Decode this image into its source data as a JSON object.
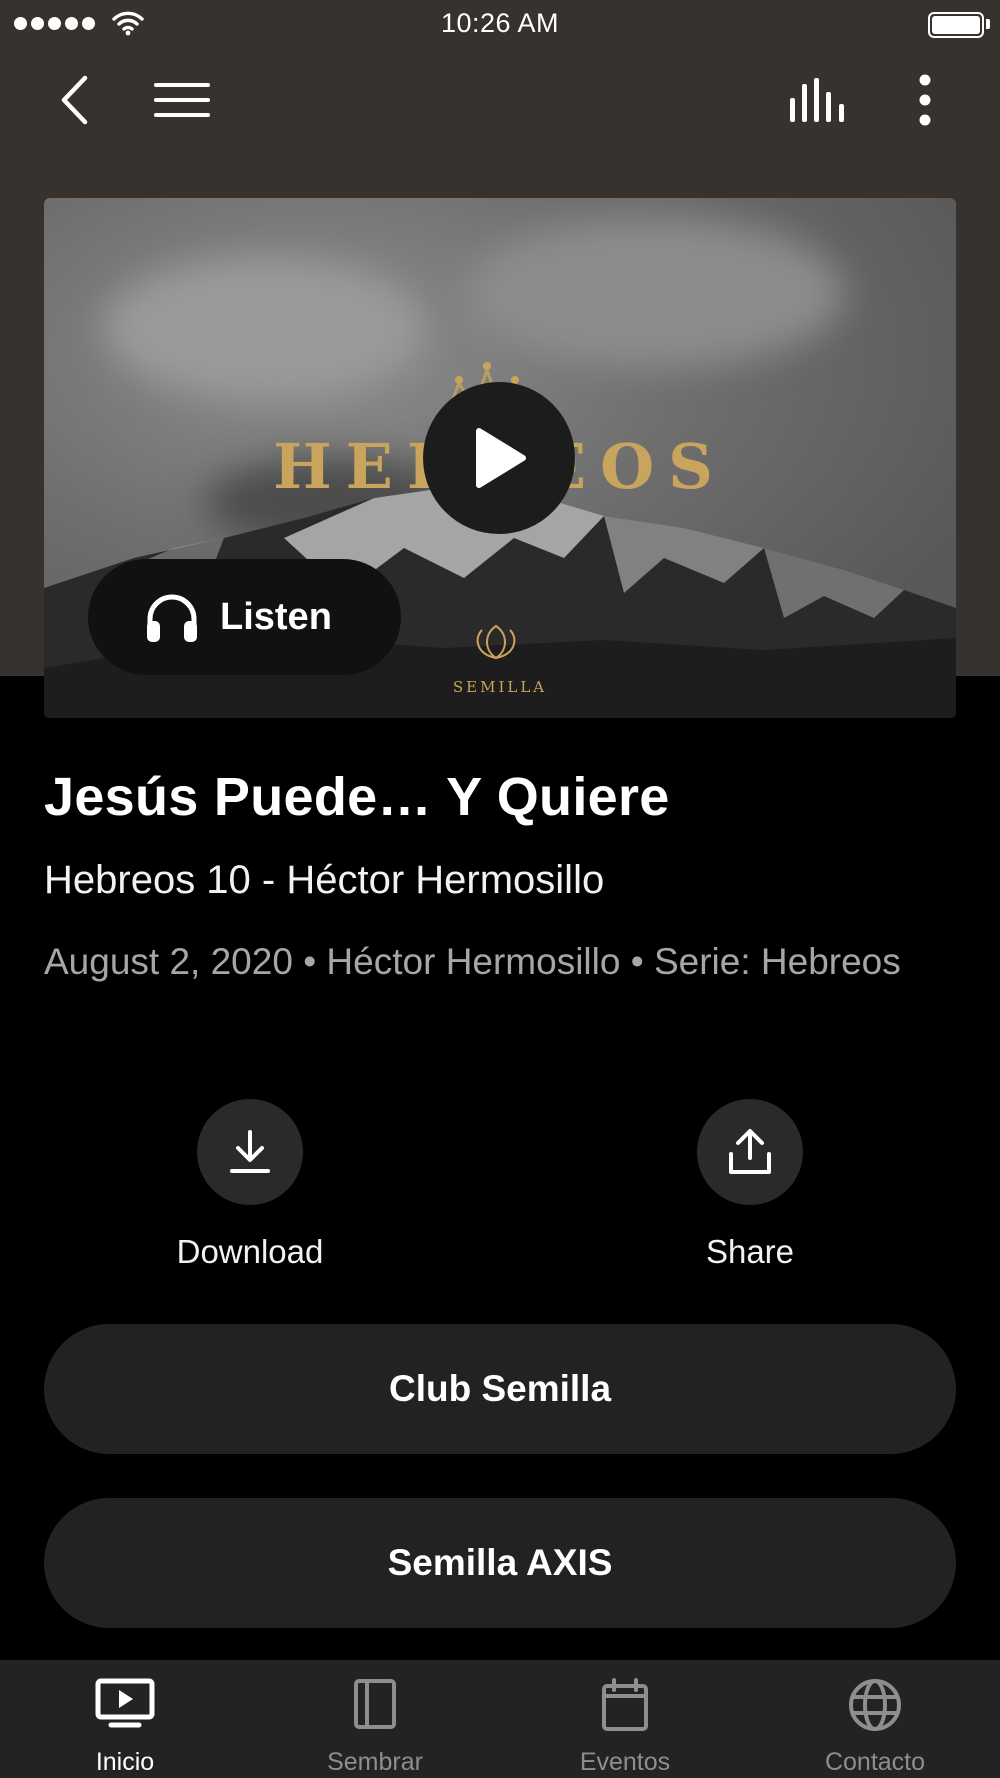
{
  "status_bar": {
    "time": "10:26 AM"
  },
  "hero": {
    "brand_title": "HEBREOS",
    "brand_subtitle": "SEMILLA",
    "listen_label": "Listen"
  },
  "episode": {
    "title": "Jesús Puede… Y Quiere",
    "subtitle": "Hebreos 10 - Héctor Hermosillo",
    "meta": "August 2, 2020 • Héctor Hermosillo • Serie: Hebreos"
  },
  "actions": {
    "download_label": "Download",
    "share_label": "Share"
  },
  "links": [
    {
      "label": "Club Semilla"
    },
    {
      "label": "Semilla AXIS"
    }
  ],
  "tabbar": {
    "active": "Inicio",
    "tabs": [
      {
        "label": "Inicio",
        "icon": "tv-play-icon"
      },
      {
        "label": "Sembrar",
        "icon": "book-icon"
      },
      {
        "label": "Eventos",
        "icon": "calendar-icon"
      },
      {
        "label": "Contacto",
        "icon": "globe-icon"
      }
    ]
  },
  "colors": {
    "header_bg": "#37322d",
    "page_bg": "#000000",
    "brand_gold": "#c9a45c",
    "pill_bg": "#222222",
    "tab_active": "#ffffff",
    "tab_inactive": "#8e8e8e"
  }
}
